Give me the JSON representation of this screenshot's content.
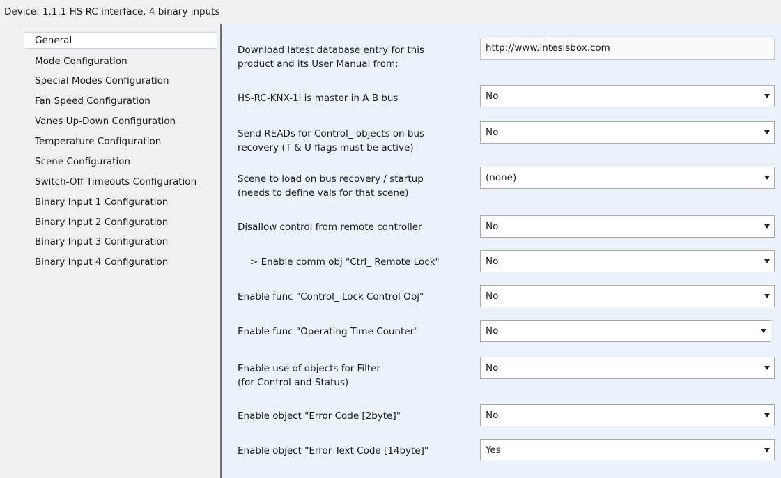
{
  "window": {
    "title": "Device: 1.1.1  HS RC interface, 4 binary inputs"
  },
  "sidebar": {
    "items": [
      {
        "label": "General",
        "selected": true
      },
      {
        "label": "Mode Configuration"
      },
      {
        "label": "Special Modes Configuration"
      },
      {
        "label": "Fan Speed Configuration"
      },
      {
        "label": "Vanes Up-Down Configuration"
      },
      {
        "label": "Temperature Configuration"
      },
      {
        "label": "Scene Configuration"
      },
      {
        "label": "Switch-Off Timeouts Configuration"
      },
      {
        "label": "Binary Input 1 Configuration"
      },
      {
        "label": "Binary Input 2 Configuration"
      },
      {
        "label": "Binary Input 3 Configuration"
      },
      {
        "label": "Binary Input 4 Configuration"
      }
    ]
  },
  "params": [
    {
      "label_lines": [
        "Download latest database entry for this",
        "product and its User Manual from:"
      ],
      "value": "http://www.intesisbox.com",
      "kind": "text"
    },
    {
      "label_lines": [
        "HS-RC-KNX-1i is master in A B bus"
      ],
      "value": "No",
      "kind": "dropdown"
    },
    {
      "label_lines": [
        "Send READs for Control_ objects on bus",
        "recovery (T & U flags must be active)"
      ],
      "value": "No",
      "kind": "dropdown"
    },
    {
      "label_lines": [
        "Scene to load on bus recovery / startup",
        "(needs to define vals for that scene)"
      ],
      "value": "(none)",
      "kind": "dropdown"
    },
    {
      "label_lines": [
        "Disallow control from remote controller"
      ],
      "value": "No",
      "kind": "dropdown"
    },
    {
      "label_lines": [
        "> Enable comm obj \"Ctrl_ Remote Lock\""
      ],
      "value": "No",
      "kind": "dropdown",
      "indented": true
    },
    {
      "label_lines": [
        "Enable func \"Control_ Lock Control Obj\""
      ],
      "value": "No",
      "kind": "dropdown"
    },
    {
      "label_lines": [
        "Enable func \"Operating Time Counter\""
      ],
      "value": "No",
      "kind": "dropdown"
    },
    {
      "label_lines": [
        "Enable use of objects for Filter",
        "(for Control and Status)"
      ],
      "value": "No",
      "kind": "dropdown"
    },
    {
      "label_lines": [
        "Enable object \"Error Code [2byte]\""
      ],
      "value": "No",
      "kind": "dropdown"
    },
    {
      "label_lines": [
        "Enable object \"Error Text Code [14byte]\""
      ],
      "value": "Yes",
      "kind": "dropdown"
    }
  ],
  "icons": {
    "dropdown": "chevron-down-icon"
  }
}
